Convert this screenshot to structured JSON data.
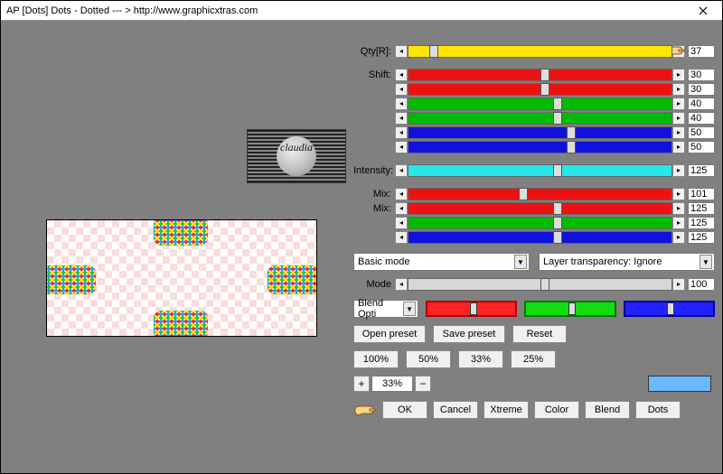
{
  "window": {
    "title": "AP [Dots]  Dots - Dotted    --- > http://www.graphicxtras.com"
  },
  "watermark": {
    "text": "claudia"
  },
  "sliders": {
    "qty": {
      "label": "Qty[R]:",
      "value": 37,
      "pos": 8,
      "fill": "#ffe600",
      "fillTo": 100
    },
    "shift_r1": {
      "label": "Shift:",
      "value": 30,
      "pos": 50,
      "fill": "#e11",
      "full": true
    },
    "shift_r2": {
      "label": "",
      "value": 30,
      "pos": 50,
      "fill": "#e11",
      "full": true
    },
    "shift_g1": {
      "label": "",
      "value": 40,
      "pos": 55,
      "fill": "#0b0",
      "full": true
    },
    "shift_g2": {
      "label": "",
      "value": 40,
      "pos": 55,
      "fill": "#0b0",
      "full": true
    },
    "shift_b1": {
      "label": "",
      "value": 50,
      "pos": 60,
      "fill": "#11d",
      "full": true
    },
    "shift_b2": {
      "label": "",
      "value": 50,
      "pos": 60,
      "fill": "#11d",
      "full": true
    },
    "intensity": {
      "label": "Intensity:",
      "value": 125,
      "pos": 55,
      "fill": "#25e8e8",
      "full": true
    },
    "mix_r": {
      "label": "Mix:",
      "value": 101,
      "pos": 42,
      "fill": "#e11",
      "full": true
    },
    "mix_r2": {
      "label": "Mix:",
      "value": 125,
      "pos": 55,
      "fill": "#e11",
      "full": true
    },
    "mix_g": {
      "label": "",
      "value": 125,
      "pos": 55,
      "fill": "#0b0",
      "full": true
    },
    "mix_b": {
      "label": "",
      "value": 125,
      "pos": 55,
      "fill": "#11d",
      "full": true
    },
    "mode": {
      "label": "Mode",
      "value": 100,
      "pos": 50,
      "fill": "#d7d7d7",
      "plain": true
    }
  },
  "dropdowns": {
    "basic": "Basic mode",
    "layer": "Layer transparency: Ignore",
    "blend_opt": "Blend Opti"
  },
  "blend_sliders": {
    "r": {
      "border": "#a00",
      "fill": "#f22",
      "pos": 50
    },
    "g": {
      "border": "#070",
      "fill": "#1d1",
      "pos": 50
    },
    "b": {
      "border": "#009",
      "fill": "#22f",
      "pos": 50
    }
  },
  "buttons": {
    "open_preset": "Open preset",
    "save_preset": "Save preset",
    "reset": "Reset",
    "p100": "100%",
    "p50": "50%",
    "p33": "33%",
    "p25": "25%",
    "ok": "OK",
    "cancel": "Cancel",
    "xtreme": "Xtreme",
    "color": "Color",
    "blend": "Blend",
    "dots": "Dots"
  },
  "zoom": {
    "value": "33%"
  }
}
